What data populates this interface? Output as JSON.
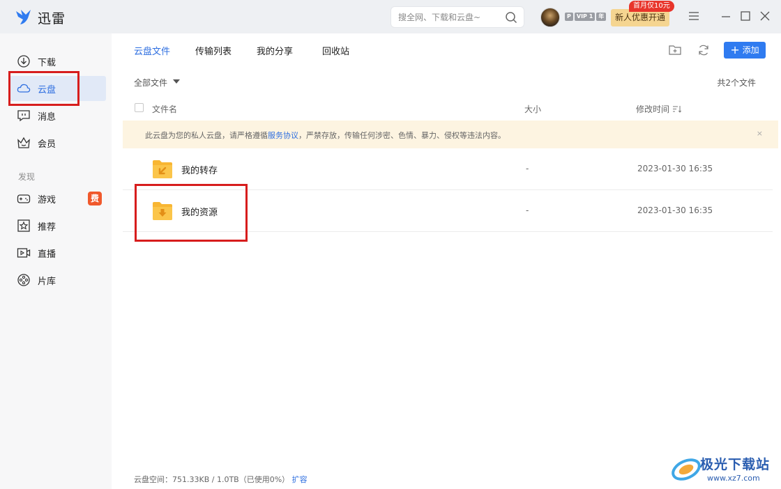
{
  "app": {
    "title": "迅雷"
  },
  "search": {
    "placeholder": "搜全网、下载和云盘~"
  },
  "account": {
    "badges": [
      "P",
      "VIP 1",
      "年"
    ],
    "promo_label": "新人优惠开通",
    "promo_tag": "首月仅10元"
  },
  "sidebar": {
    "items": [
      {
        "label": "下载",
        "icon": "download-icon"
      },
      {
        "label": "云盘",
        "icon": "cloud-icon",
        "active": true
      },
      {
        "label": "消息",
        "icon": "message-icon"
      },
      {
        "label": "会员",
        "icon": "crown-icon"
      }
    ],
    "section_label": "发现",
    "discover": [
      {
        "label": "游戏",
        "icon": "gamepad-icon",
        "badge": "费"
      },
      {
        "label": "推荐",
        "icon": "star-icon"
      },
      {
        "label": "直播",
        "icon": "live-icon"
      },
      {
        "label": "片库",
        "icon": "film-reel-icon"
      }
    ]
  },
  "tabs": [
    {
      "label": "云盘文件",
      "active": true
    },
    {
      "label": "传输列表"
    },
    {
      "label": "我的分享"
    },
    {
      "label": "回收站"
    }
  ],
  "toolbar": {
    "add_label": "添加"
  },
  "filter": {
    "label": "全部文件",
    "file_count": "共2个文件"
  },
  "table": {
    "headers": {
      "name": "文件名",
      "size": "大小",
      "modified": "修改时间"
    },
    "rows": [
      {
        "name": "我的转存",
        "size": "-",
        "modified": "2023-01-30 16:35"
      },
      {
        "name": "我的资源",
        "size": "-",
        "modified": "2023-01-30 16:35"
      }
    ]
  },
  "notice": {
    "prefix": "此云盘为您的私人云盘，请严格遵循",
    "link": "服务协议",
    "suffix": "，严禁存放，传输任何涉密、色情、暴力、侵权等违法内容。",
    "close": "×"
  },
  "storage": {
    "label": "云盘空间：751.33KB / 1.0TB（已使用0%）",
    "expand": "扩容"
  },
  "watermark": {
    "name": "极光下载站",
    "url": "www.xz7.com"
  },
  "colors": {
    "accent": "#2f7bf0",
    "highlight": "#d71d1d",
    "notice_bg": "#fdf4e1"
  }
}
